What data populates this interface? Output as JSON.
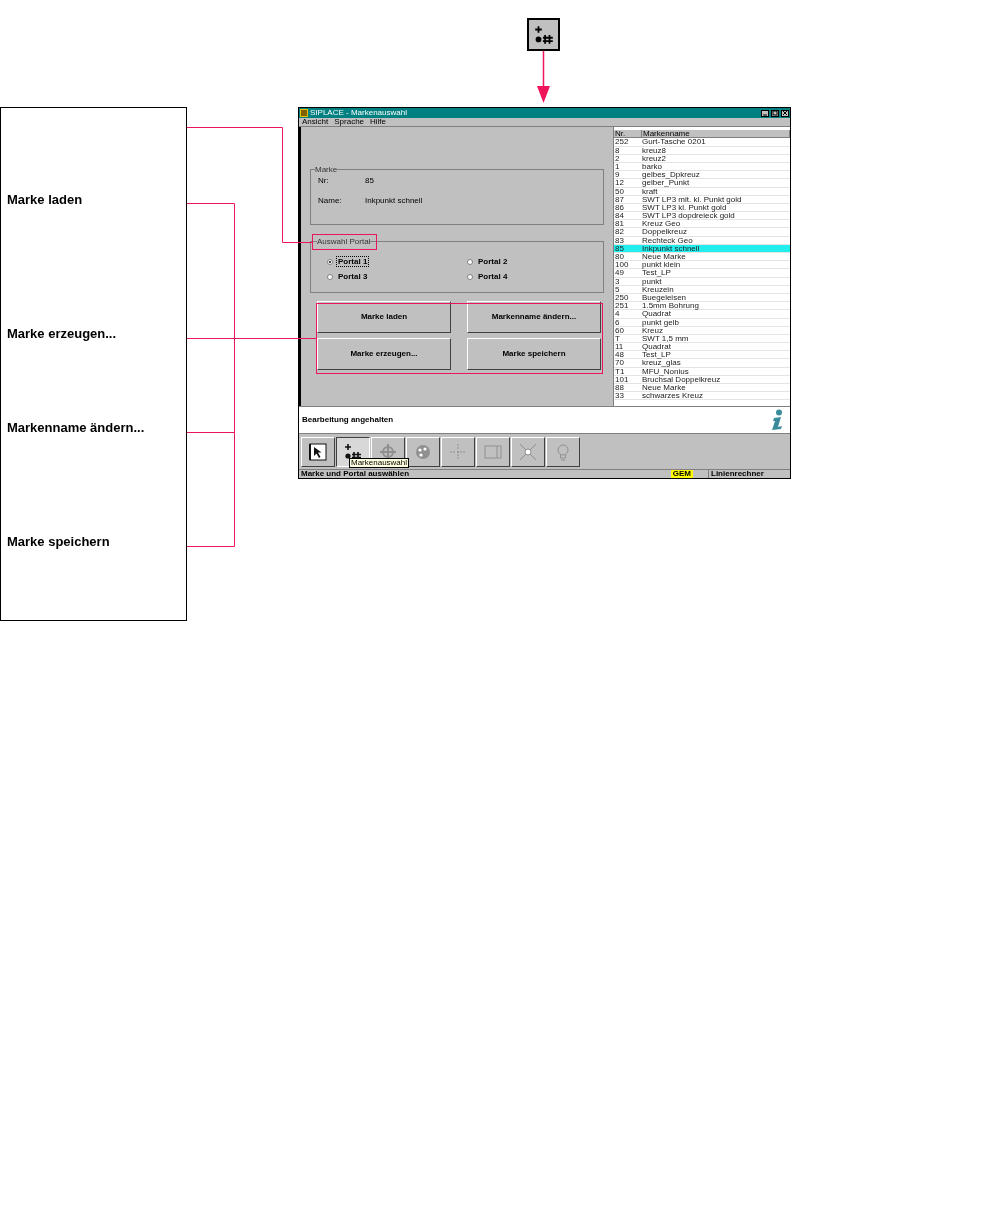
{
  "callout_labels": [
    "Marke laden",
    "Marke erzeugen...",
    "Markenname ändern...",
    "Marke speichern"
  ],
  "window": {
    "title": "SIPLACE - Markenauswahl",
    "menu": [
      "Ansicht",
      "Sprache",
      "Hilfe"
    ],
    "marke_group": {
      "label": "Marke",
      "fields": [
        {
          "label": "Nr:",
          "value": "85"
        },
        {
          "label": "Name:",
          "value": "Inkpunkt schnell"
        }
      ]
    },
    "portal_group": {
      "label": "Auswahl Portal",
      "options": [
        {
          "label": "Portal 1",
          "selected": true
        },
        {
          "label": "Portal 2",
          "selected": false
        },
        {
          "label": "Portal 3",
          "selected": false
        },
        {
          "label": "Portal 4",
          "selected": false
        }
      ]
    },
    "buttons": [
      "Marke laden",
      "Markenname ändern...",
      "Marke erzeugen...",
      "Marke speichern"
    ],
    "list": {
      "columns": [
        "Nr.",
        "Markenname"
      ],
      "rows": [
        {
          "nr": "252",
          "name": "Gurt-Tasche 0201",
          "selected": false
        },
        {
          "nr": "8",
          "name": "kreuz8",
          "selected": false
        },
        {
          "nr": "2",
          "name": "kreuz2",
          "selected": false
        },
        {
          "nr": "1",
          "name": "barko",
          "selected": false
        },
        {
          "nr": "9",
          "name": "gelbes_Dpkreuz",
          "selected": false
        },
        {
          "nr": "12",
          "name": "gelber_Punkt",
          "selected": false
        },
        {
          "nr": "50",
          "name": "kraft",
          "selected": false
        },
        {
          "nr": "87",
          "name": "SWT LP3 mit. kl. Punkt gold",
          "selected": false
        },
        {
          "nr": "86",
          "name": "SWT LP3 kl. Punkt gold",
          "selected": false
        },
        {
          "nr": "84",
          "name": "SWT LP3 dopdreieck gold",
          "selected": false
        },
        {
          "nr": "81",
          "name": "Kreuz Geo",
          "selected": false
        },
        {
          "nr": "82",
          "name": "Doppelkreuz",
          "selected": false
        },
        {
          "nr": "83",
          "name": "Rechteck Geo",
          "selected": false
        },
        {
          "nr": "85",
          "name": "Inkpunkt schnell",
          "selected": true
        },
        {
          "nr": "80",
          "name": "Neue Marke",
          "selected": false
        },
        {
          "nr": "100",
          "name": "punkt klein",
          "selected": false
        },
        {
          "nr": "49",
          "name": "Test_LP",
          "selected": false
        },
        {
          "nr": "3",
          "name": "punkt",
          "selected": false
        },
        {
          "nr": "5",
          "name": "Kreuzein",
          "selected": false
        },
        {
          "nr": "250",
          "name": "Buegeleisen",
          "selected": false
        },
        {
          "nr": "251",
          "name": "1.5mm Bohrung",
          "selected": false
        },
        {
          "nr": "4",
          "name": "Quadrat",
          "selected": false
        },
        {
          "nr": "6",
          "name": "punkt gelb",
          "selected": false
        },
        {
          "nr": "60",
          "name": "Kreuz",
          "selected": false
        },
        {
          "nr": "T",
          "name": "SWT 1,5 mm",
          "selected": false
        },
        {
          "nr": "11",
          "name": "Quadrat",
          "selected": false
        },
        {
          "nr": "48",
          "name": "Test_LP",
          "selected": false
        },
        {
          "nr": "70",
          "name": "kreuz_glas",
          "selected": false
        },
        {
          "nr": "T1",
          "name": "MFU_Nonius",
          "selected": false
        },
        {
          "nr": "101",
          "name": "Bruchsal Doppelkreuz",
          "selected": false
        },
        {
          "nr": "88",
          "name": "Neue Marke",
          "selected": false
        },
        {
          "nr": "33",
          "name": "schwarzes Kreuz",
          "selected": false
        }
      ]
    },
    "message": "Bearbeitung angehalten",
    "toolbar": [
      {
        "kind": "pointer",
        "selected": false,
        "disabled": false
      },
      {
        "kind": "marker",
        "selected": true,
        "disabled": false
      },
      {
        "kind": "target",
        "selected": false,
        "disabled": true
      },
      {
        "kind": "palette",
        "selected": false,
        "disabled": true
      },
      {
        "kind": "crosshair",
        "selected": false,
        "disabled": true
      },
      {
        "kind": "frame",
        "selected": false,
        "disabled": true
      },
      {
        "kind": "cross",
        "selected": false,
        "disabled": true
      },
      {
        "kind": "bulb",
        "selected": false,
        "disabled": true
      }
    ],
    "tooltip": "Markenauswahl",
    "status_bar": {
      "hint": "Marke und Portal auswählen",
      "badge": "GEM",
      "computer": "Linienrechner"
    }
  }
}
